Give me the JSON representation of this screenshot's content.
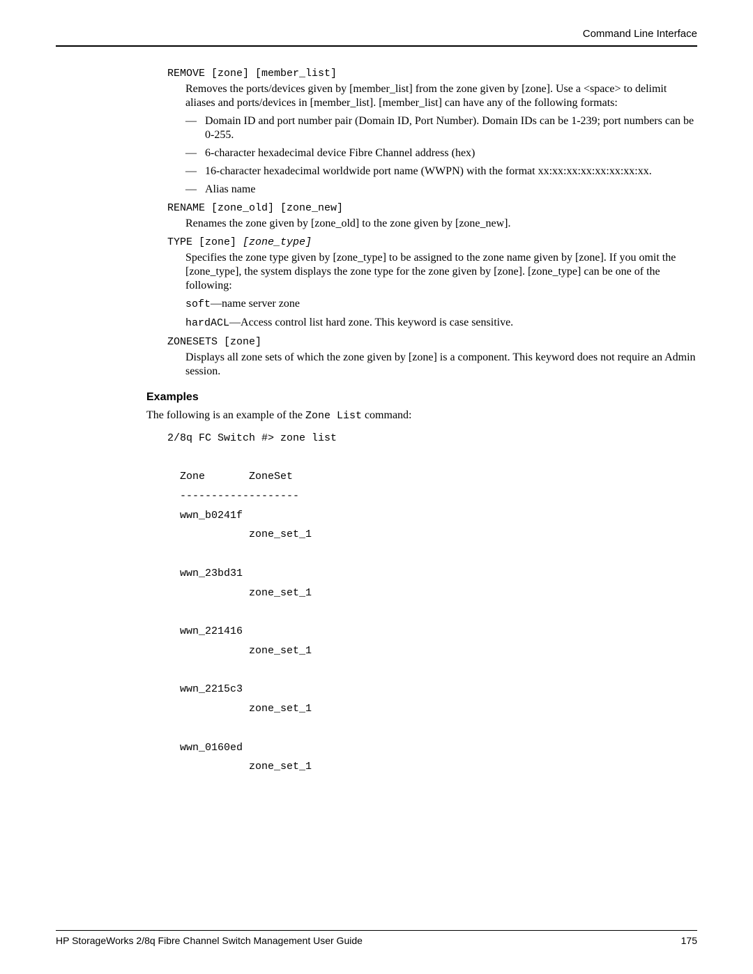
{
  "header": {
    "section_title": "Command Line Interface"
  },
  "commands": {
    "remove": {
      "syntax_prefix": "REMOVE [zone] [member_list]",
      "desc": "Removes the ports/devices given by [member_list] from the zone given by [zone]. Use a <space> to delimit aliases and ports/devices in [member_list]. [member_list] can have any of the following formats:",
      "bullets": [
        "Domain ID and port number pair (Domain ID, Port Number). Domain IDs can be 1-239; port numbers can be 0-255.",
        "6-character hexadecimal device Fibre Channel address (hex)",
        "16-character hexadecimal worldwide port name (WWPN) with the format xx:xx:xx:xx:xx:xx:xx:xx.",
        "Alias name"
      ]
    },
    "rename": {
      "syntax": "RENAME [zone_old] [zone_new]",
      "desc": "Renames the zone given by [zone_old] to the zone given by [zone_new]."
    },
    "type": {
      "syntax_plain": "TYPE [zone] ",
      "syntax_ital": "[zone_type]",
      "desc": "Specifies the zone type given by [zone_type] to be assigned to the zone name given by [zone]. If you omit the [zone_type], the system displays the zone type for the zone given by [zone]. [zone_type] can be one of the following:",
      "opt1_code": "soft",
      "opt1_rest": "—name server zone",
      "opt2_code": "hardACL",
      "opt2_rest": "—Access control list hard zone. This keyword is case sensitive."
    },
    "zonesets": {
      "syntax": "ZONESETS [zone]",
      "desc": "Displays all zone sets of which the zone given by [zone] is a component. This keyword does not require an Admin session."
    }
  },
  "examples": {
    "heading": "Examples",
    "intro_pre": "The following is an example of the ",
    "intro_code": "Zone List",
    "intro_post": " command:",
    "code": "2/8q FC Switch #> zone list\n\n  Zone       ZoneSet\n  -------------------\n  wwn_b0241f\n             zone_set_1\n\n  wwn_23bd31\n             zone_set_1\n\n  wwn_221416\n             zone_set_1\n\n  wwn_2215c3\n             zone_set_1\n\n  wwn_0160ed\n             zone_set_1"
  },
  "footer": {
    "doc_title": "HP StorageWorks 2/8q Fibre Channel Switch Management User Guide",
    "page_number": "175"
  }
}
